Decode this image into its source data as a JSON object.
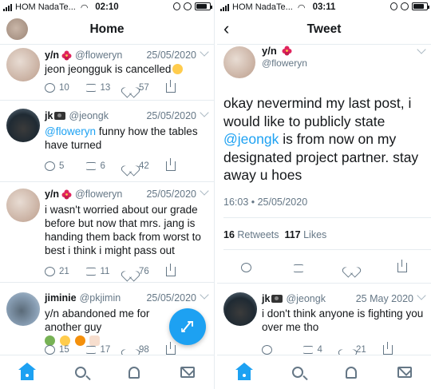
{
  "left": {
    "status": {
      "carrier": "HOM NadaTe...",
      "time": "02:10"
    },
    "nav": {
      "title": "Home"
    },
    "tweets": [
      {
        "name": "y/n",
        "handle": "@floweryn",
        "date": "25/05/2020",
        "text": "jeon jeongguk is cancelled",
        "replies": "10",
        "retweets": "13",
        "likes": "57"
      },
      {
        "name": "jk",
        "handle": "@jeongk",
        "date": "25/05/2020",
        "mention": "@floweryn",
        "text": " funny how the tables have turned",
        "replies": "5",
        "retweets": "6",
        "likes": "42"
      },
      {
        "name": "y/n",
        "handle": "@floweryn",
        "date": "25/05/2020",
        "text": "i wasn't worried about our grade before but now that mrs. jang is handing them back from worst to best i think i might pass out",
        "replies": "21",
        "retweets": "11",
        "likes": "76"
      },
      {
        "name": "jiminie",
        "handle": "@pkjimin",
        "date": "25/05/2020",
        "text": "y/n abandoned me for another guy",
        "replies": "15",
        "retweets": "17",
        "likes": "98"
      }
    ]
  },
  "right": {
    "status": {
      "carrier": "HOM NadaTe...",
      "time": "03:11"
    },
    "nav": {
      "title": "Tweet",
      "back": "‹"
    },
    "detail": {
      "name": "y/n",
      "handle": "@floweryn",
      "text_before": "okay nevermind my last post, i would like to publicly state ",
      "mention": "@jeongk",
      "text_after": " is from now on my designated project partner. stay away u hoes",
      "time": "16:03 • 25/05/2020",
      "retweets": "16",
      "retweets_label": "Retweets",
      "likes": "117",
      "likes_label": "Likes"
    },
    "reply": {
      "name": "jk",
      "handle": "@jeongk",
      "date": "25 May 2020",
      "text": "i don't think anyone is fighting you over me tho",
      "retweets": "4",
      "likes": "21"
    }
  },
  "colors": {
    "accent": "#1da1f2",
    "muted": "#657786",
    "text": "#14171a",
    "border": "#e6ecf0"
  },
  "icons": [
    "reply-icon",
    "retweet-icon",
    "like-icon",
    "share-icon",
    "compose-icon",
    "home-icon",
    "search-icon",
    "notifications-icon",
    "messages-icon"
  ]
}
